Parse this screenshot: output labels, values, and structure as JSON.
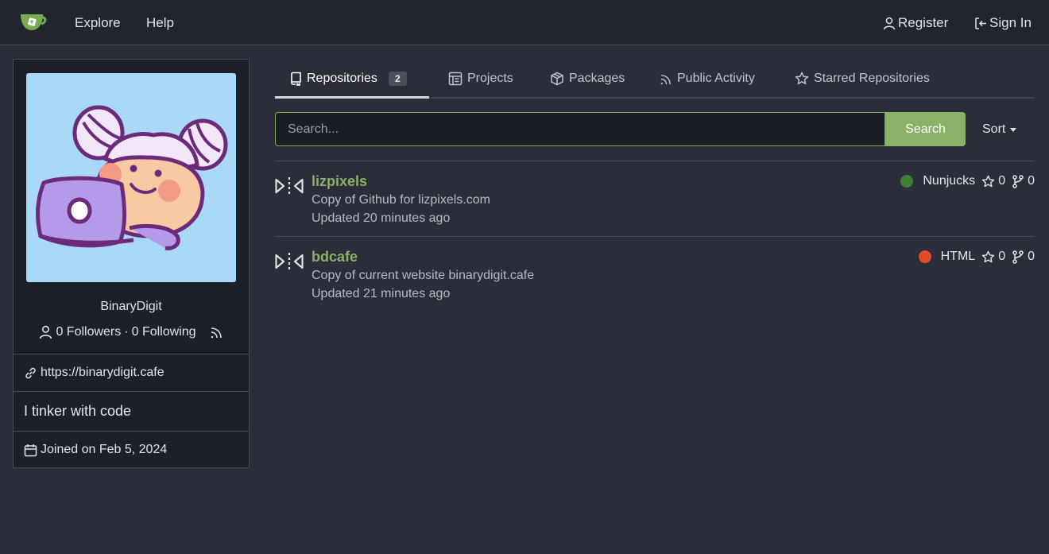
{
  "nav": {
    "explore": "Explore",
    "help": "Help",
    "register": "Register",
    "sign_in": "Sign In"
  },
  "profile": {
    "username": "BinaryDigit",
    "followers": "0 Followers",
    "separator": "·",
    "following": "0 Following",
    "website": "https://binarydigit.cafe",
    "bio": "I tinker with code",
    "joined": "Joined on Feb 5, 2024"
  },
  "tabs": [
    {
      "label": "Repositories",
      "count": "2",
      "icon": "repo-icon",
      "active": true
    },
    {
      "label": "Projects",
      "icon": "project-icon"
    },
    {
      "label": "Packages",
      "icon": "package-icon"
    },
    {
      "label": "Public Activity",
      "icon": "rss-icon"
    },
    {
      "label": "Starred Repositories",
      "icon": "star-icon"
    }
  ],
  "search": {
    "placeholder": "Search...",
    "button": "Search",
    "sort": "Sort"
  },
  "repos": [
    {
      "name": "lizpixels",
      "description": "Copy of Github for lizpixels.com",
      "updated": "Updated 20 minutes ago",
      "language": "Nunjucks",
      "language_color": "#3d8137",
      "stars": "0",
      "forks": "0"
    },
    {
      "name": "bdcafe",
      "description": "Copy of current website binarydigit.cafe",
      "updated": "Updated 21 minutes ago",
      "language": "HTML",
      "language_color": "#e34c26",
      "stars": "0",
      "forks": "0"
    }
  ],
  "colors": {
    "accent": "#8bb068",
    "background": "#2b2e38",
    "navbar": "#21252d"
  }
}
